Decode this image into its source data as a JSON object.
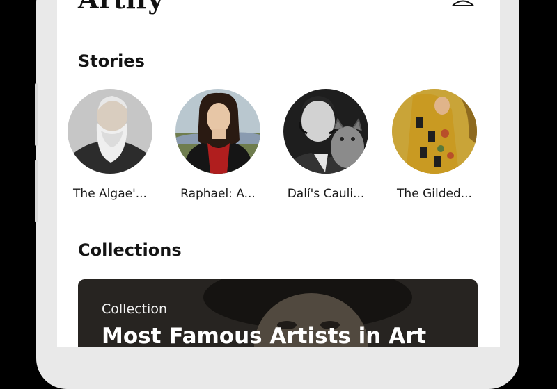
{
  "app": {
    "title": "Artify"
  },
  "stories": {
    "heading": "Stories",
    "items": [
      {
        "label": "The Algae'...",
        "image": "monet-portrait"
      },
      {
        "label": "Raphael: A...",
        "image": "renaissance-portrait"
      },
      {
        "label": "Dalí's Cauli...",
        "image": "dali-with-cat"
      },
      {
        "label": "The Gilded...",
        "image": "klimt-the-kiss"
      }
    ]
  },
  "collections": {
    "heading": "Collections",
    "card": {
      "tag": "Collection",
      "title": "Most Famous Artists in Art"
    }
  },
  "icons": {
    "profile": "person-icon"
  },
  "colors": {
    "frame": "#e9e9e9",
    "screen": "#ffffff",
    "text": "#141414",
    "card_overlay": "#3b3630"
  }
}
